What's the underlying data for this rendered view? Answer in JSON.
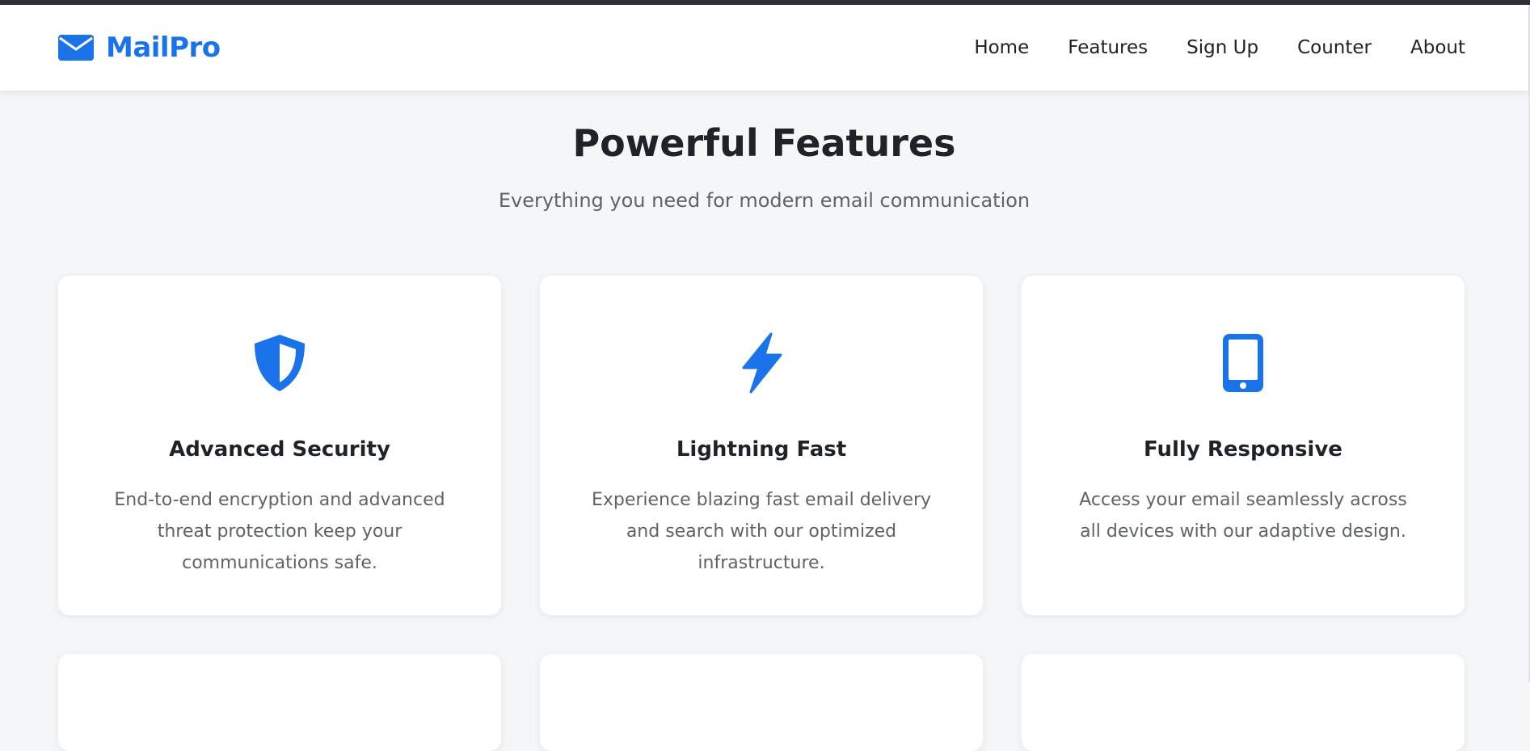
{
  "brand": {
    "name": "MailPro",
    "icon": "envelope-icon",
    "color": "#1a73e8"
  },
  "nav": {
    "items": [
      {
        "label": "Home"
      },
      {
        "label": "Features"
      },
      {
        "label": "Sign Up"
      },
      {
        "label": "Counter"
      },
      {
        "label": "About"
      }
    ]
  },
  "features": {
    "title": "Powerful Features",
    "subtitle": "Everything you need for modern email communication",
    "cards": [
      {
        "icon": "shield-icon",
        "title": "Advanced Security",
        "text": "End-to-end encryption and advanced threat protection keep your communications safe."
      },
      {
        "icon": "lightning-bolt-icon",
        "title": "Lightning Fast",
        "text": "Experience blazing fast email delivery and search with our optimized infrastructure."
      },
      {
        "icon": "mobile-phone-icon",
        "title": "Fully Responsive",
        "text": "Access your email seamlessly across all devices with our adaptive design."
      }
    ]
  },
  "colors": {
    "accent": "#1a73e8",
    "page_background": "#f5f6f8",
    "card_background": "#ffffff"
  }
}
